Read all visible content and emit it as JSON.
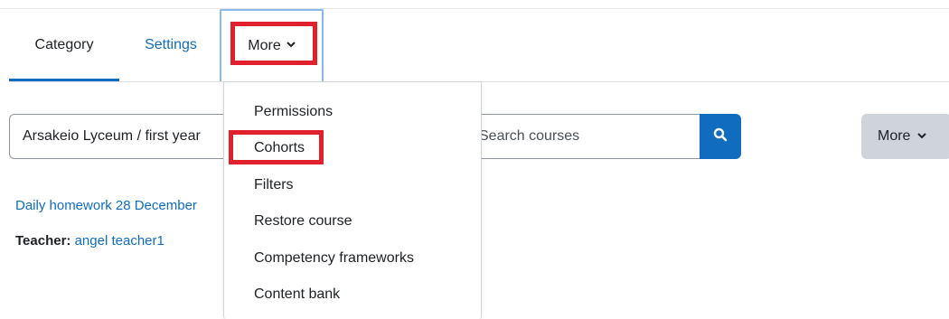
{
  "tabs": [
    {
      "label": "Category"
    },
    {
      "label": "Settings"
    },
    {
      "label": "More"
    }
  ],
  "dropdown": {
    "items": [
      "Permissions",
      "Cohorts",
      "Filters",
      "Restore course",
      "Competency frameworks",
      "Content bank"
    ]
  },
  "course_selector": {
    "value": "Arsakeio Lyceum / first year"
  },
  "search": {
    "placeholder": "Search courses"
  },
  "more_button": {
    "label": "More"
  },
  "course": {
    "name": "Daily homework 28 December",
    "teacher_label": "Teacher:",
    "teacher_name": "angel teacher1"
  },
  "icons": {
    "search": "search-icon",
    "chevron": "chevron-down-icon"
  },
  "colors": {
    "accent": "#0f6cbf",
    "highlight": "#e0202a",
    "button_grey": "#ced4da"
  }
}
